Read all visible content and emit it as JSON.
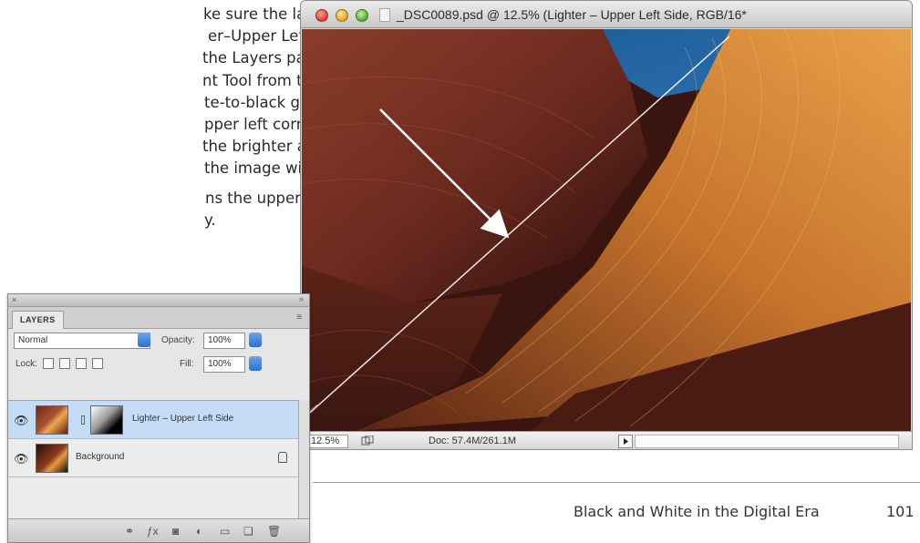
{
  "body_text": {
    "lines": [
      "ke sure the layer mask on",
      "er–Upper Left Side” layer is",
      " the Layers palette. Choose",
      "nt Tool from the Toolbox and",
      "te-to-black gradient diagonally",
      "pper left corner of the image",
      " the brighter area in the",
      "the image window.",
      "ns the upper left side in a",
      "y."
    ]
  },
  "window": {
    "title": "_DSC0089.psd @ 12.5% (Lighter – Upper Left Side, RGB/16*",
    "zoom": "12.5%",
    "doc_size": "Doc: 57.4M/261.1M",
    "icons": [
      "close-icon",
      "minimize-icon",
      "zoom-icon",
      "document-icon",
      "status-menu-icon"
    ]
  },
  "palette": {
    "tab": "LAYERS",
    "blend_mode": "Normal",
    "opacity_label": "Opacity:",
    "opacity_value": "100%",
    "lock_label": "Lock:",
    "fill_label": "Fill:",
    "fill_value": "100%",
    "layers": [
      {
        "name": "Lighter – Upper Left Side",
        "selected": true
      },
      {
        "name": "Background",
        "selected": false
      }
    ],
    "colors": {
      "selected_row": "#c4dcf6",
      "dropdown_accent": "#2d6fcf"
    }
  },
  "footer": {
    "title": "Black and White in the Digital Era",
    "page": "101"
  }
}
